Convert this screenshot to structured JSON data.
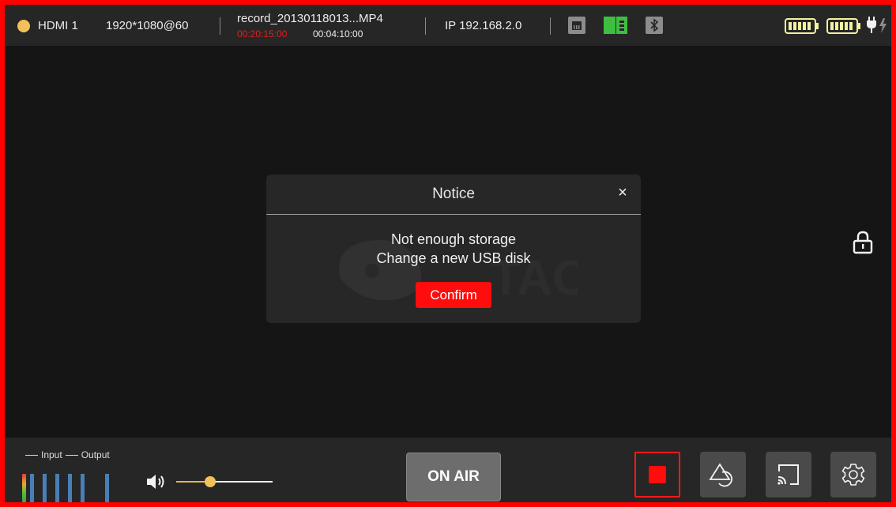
{
  "status": {
    "source": "HDMI 1",
    "resolution": "1920*1080@60",
    "record_file": "record_20130118013...MP4",
    "elapsed": "00:20:15:00",
    "total": "00:04:10:00",
    "ip": "IP 192.168.2.0",
    "icons": [
      "ethernet-icon",
      "sd-card-icon",
      "bluetooth-icon",
      "battery-icon",
      "battery-icon",
      "power-plug-icon"
    ],
    "colors": {
      "source_dot": "#f1c15a",
      "elapsed": "#e02020",
      "sd_card": "#3fbf3f",
      "battery": "#f2f2a0"
    }
  },
  "dialog": {
    "title": "Notice",
    "close_glyph": "×",
    "message_line1": "Not enough storage",
    "message_line2": "Change a new USB disk",
    "confirm_label": "Confirm",
    "watermark_text": "TAO"
  },
  "bottom": {
    "legend_input": "Input",
    "legend_output": "Output",
    "volume_level": 0.35,
    "on_air_label": "ON AIR",
    "buttons": [
      "record-stop",
      "shapes",
      "cast",
      "settings"
    ],
    "accent": "#ff0d0d"
  }
}
